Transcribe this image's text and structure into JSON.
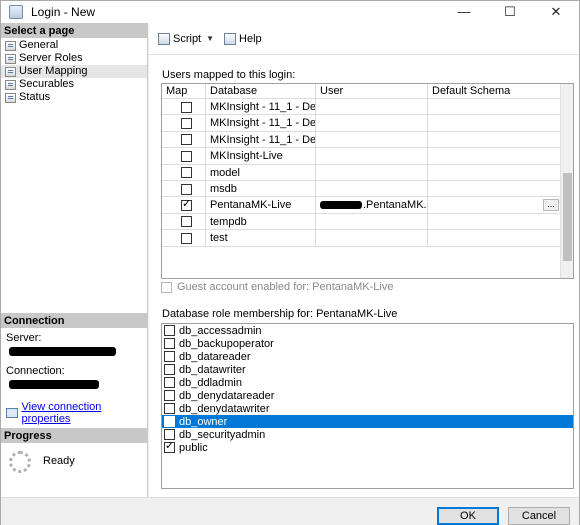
{
  "window": {
    "title": "Login - New",
    "minimize": "—",
    "maximize": "☐",
    "close": "✕"
  },
  "select_page": {
    "header": "Select a page",
    "items": [
      {
        "label": "General"
      },
      {
        "label": "Server Roles"
      },
      {
        "label": "User Mapping",
        "selected": true
      },
      {
        "label": "Securables"
      },
      {
        "label": "Status"
      }
    ]
  },
  "connection": {
    "header": "Connection",
    "server_label": "Server:",
    "connection_label": "Connection:",
    "link": "View connection properties"
  },
  "progress": {
    "header": "Progress",
    "status": "Ready"
  },
  "toolbar": {
    "script_label": "Script",
    "help_label": "Help"
  },
  "users_mapped": {
    "label": "Users mapped to this login:",
    "columns": [
      "Map",
      "Database",
      "User",
      "Default Schema"
    ],
    "rows": [
      {
        "checked": false,
        "database": "MKInsight - 11_1 - De...",
        "user": "",
        "schema": ""
      },
      {
        "checked": false,
        "database": "MKInsight - 11_1 - De...",
        "user": "",
        "schema": ""
      },
      {
        "checked": false,
        "database": "MKInsight - 11_1 - De...",
        "user": "",
        "schema": ""
      },
      {
        "checked": false,
        "database": "MKInsight-Live",
        "user": "",
        "schema": ""
      },
      {
        "checked": false,
        "database": "model",
        "user": "",
        "schema": ""
      },
      {
        "checked": false,
        "database": "msdb",
        "user": "",
        "schema": ""
      },
      {
        "checked": true,
        "database": "PentanaMK-Live",
        "user": ".PentanaMK...",
        "schema": "",
        "ellipsis": "..."
      },
      {
        "checked": false,
        "database": "tempdb",
        "user": "",
        "schema": ""
      },
      {
        "checked": false,
        "database": "test",
        "user": "",
        "schema": ""
      }
    ]
  },
  "guest": {
    "label": "Guest account enabled for: PentanaMK-Live",
    "enabled": false
  },
  "roles": {
    "label": "Database role membership for: PentanaMK-Live",
    "items": [
      {
        "name": "db_accessadmin",
        "checked": false
      },
      {
        "name": "db_backupoperator",
        "checked": false
      },
      {
        "name": "db_datareader",
        "checked": false
      },
      {
        "name": "db_datawriter",
        "checked": false
      },
      {
        "name": "db_ddladmin",
        "checked": false
      },
      {
        "name": "db_denydatareader",
        "checked": false
      },
      {
        "name": "db_denydatawriter",
        "checked": false
      },
      {
        "name": "db_owner",
        "checked": true,
        "selected": true
      },
      {
        "name": "db_securityadmin",
        "checked": false
      },
      {
        "name": "public",
        "checked": true
      }
    ]
  },
  "buttons": {
    "ok": "OK",
    "cancel": "Cancel"
  }
}
